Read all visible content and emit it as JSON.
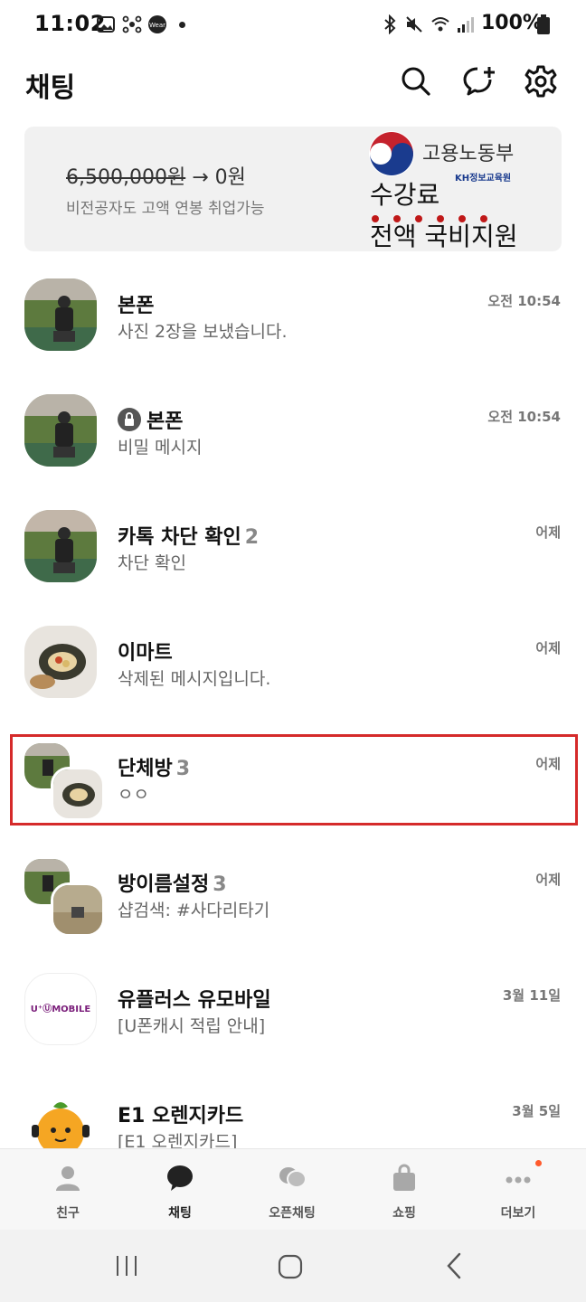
{
  "status_bar": {
    "time": "11:02",
    "battery": "100%",
    "icons": [
      "gallery-icon",
      "share-icon",
      "wear-icon",
      "dot-icon",
      "bluetooth-icon",
      "mute-icon",
      "wifi-icon",
      "signal-icon",
      "battery-icon"
    ]
  },
  "header": {
    "title": "채팅",
    "actions": [
      "search-icon",
      "new-chat-icon",
      "settings-icon"
    ]
  },
  "banner": {
    "old_price": "6,500,000원",
    "arrow": "→",
    "new_price": "0원",
    "subtitle": "비전공자도 고액 연봉 취업가능",
    "org_name": "고용노동부",
    "partner": "KH정보교육원",
    "headline1": "수강료",
    "headline2": "전액 국비지원",
    "accent": "#c01818"
  },
  "chats": [
    {
      "name": "본폰",
      "count": "",
      "preview": "사진 2장을 보냈습니다.",
      "time": "오전 10:54",
      "locked": false
    },
    {
      "name": "본폰",
      "count": "",
      "preview": "비밀 메시지",
      "time": "오전 10:54",
      "locked": true
    },
    {
      "name": "카톡 차단 확인",
      "count": "2",
      "preview": "차단 확인",
      "time": "어제",
      "locked": false
    },
    {
      "name": "이마트",
      "count": "",
      "preview": "삭제된 메시지입니다.",
      "time": "어제",
      "locked": false
    },
    {
      "name": "단체방",
      "count": "3",
      "preview": "ㅇㅇ",
      "time": "어제",
      "locked": false
    },
    {
      "name": "방이름설정",
      "count": "3",
      "preview": "샵검색: #사다리타기",
      "time": "어제",
      "locked": false
    },
    {
      "name": "유플러스 유모바일",
      "count": "",
      "preview": "[U폰캐시 적립 안내]",
      "time": "3월 11일",
      "locked": false
    },
    {
      "name": "E1 오렌지카드",
      "count": "",
      "preview": "[E1 오렌지카드]",
      "time": "3월 5일",
      "locked": false
    }
  ],
  "umobile_logo": "U⁺ⓊMOBILE",
  "bottom_nav": [
    {
      "label": "친구",
      "icon": "person-icon"
    },
    {
      "label": "채팅",
      "icon": "chat-bubble-icon"
    },
    {
      "label": "오픈채팅",
      "icon": "open-chat-icon"
    },
    {
      "label": "쇼핑",
      "icon": "shopping-bag-icon"
    },
    {
      "label": "더보기",
      "icon": "more-icon"
    }
  ],
  "colors": {
    "highlight": "#d52a2a",
    "active_nav": "#222222"
  }
}
